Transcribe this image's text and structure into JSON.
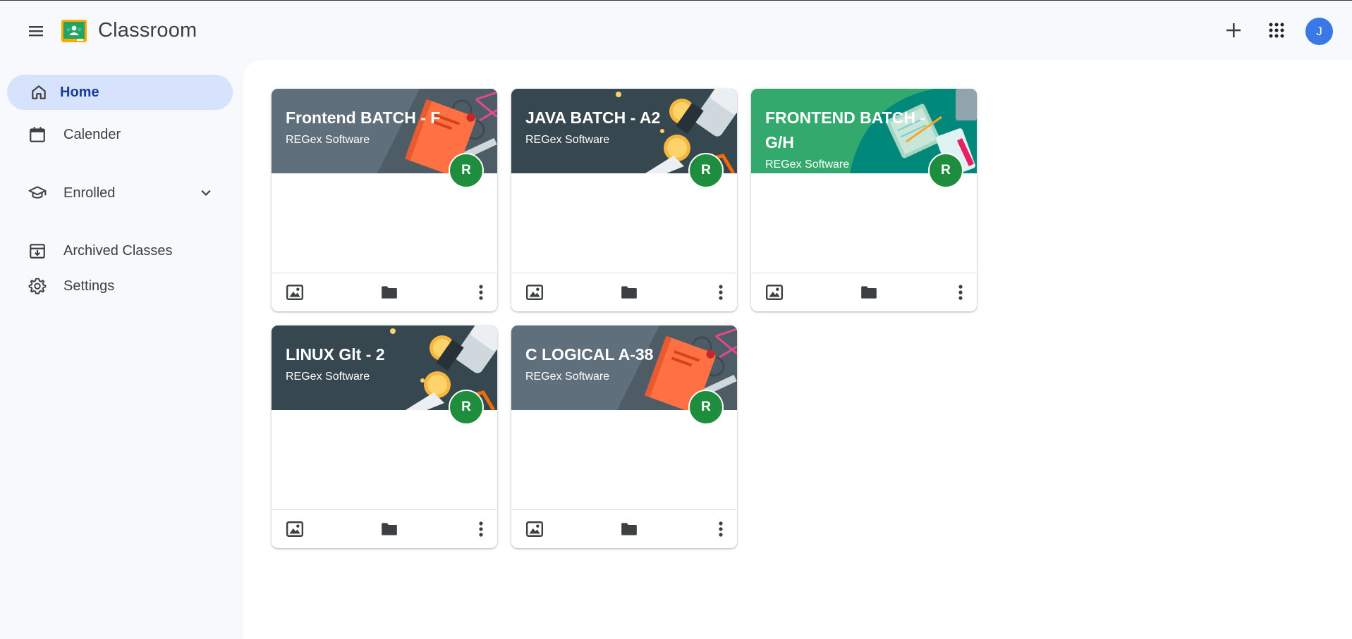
{
  "header": {
    "app_title": "Classroom",
    "avatar_initial": "J",
    "menu_icon": "hamburger-menu-icon",
    "add_icon": "plus-icon",
    "apps_icon": "apps-grid-icon"
  },
  "sidebar": {
    "items": [
      {
        "label": "Home",
        "icon": "home-icon",
        "active": true
      },
      {
        "label": "Calender",
        "icon": "calendar-icon"
      },
      {
        "label": "Enrolled",
        "icon": "school-cap-icon"
      },
      {
        "label": "Archived Classes",
        "icon": "archive-icon"
      },
      {
        "label": "Settings",
        "icon": "gear-icon"
      }
    ]
  },
  "cards": [
    {
      "title": "Frontend BATCH - F",
      "subtitle": "REGex Software",
      "badge": "R",
      "theme": "slate-book"
    },
    {
      "title": "JAVA BATCH - A2",
      "subtitle": "REGex Software",
      "badge": "R",
      "theme": "dark-coins"
    },
    {
      "title": "FRONTEND BATCH - G/H",
      "subtitle": "REGex Software",
      "badge": "R",
      "theme": "green-notebook"
    },
    {
      "title": "LINUX Glt - 2",
      "subtitle": "REGex Software",
      "badge": "R",
      "theme": "dark-coins"
    },
    {
      "title": "C LOGICAL A-38",
      "subtitle": "REGex Software",
      "badge": "R",
      "theme": "slate-book"
    }
  ],
  "colors": {
    "accent": "#1a3d91",
    "active_nav_bg": "#d7e3fc",
    "badge_green": "#1e8e3e",
    "avatar_blue": "#3b78e7",
    "slate_banner": "#5f6f7b",
    "dark_banner": "#37474f",
    "green_banner": "#34a96d"
  }
}
